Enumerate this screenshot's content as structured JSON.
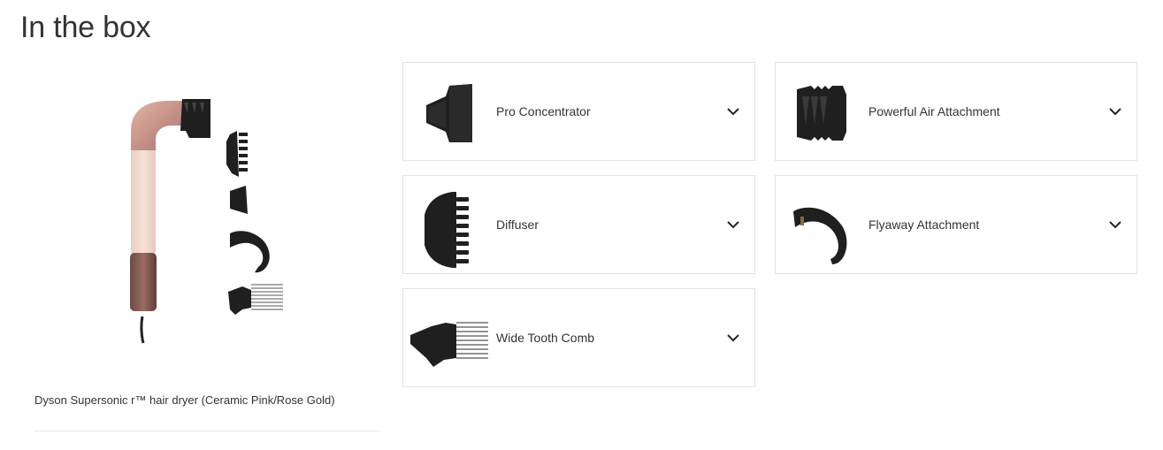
{
  "section": {
    "title": "In the box"
  },
  "hero": {
    "caption": "Dyson Supersonic r™ hair dryer (Ceramic Pink/Rose Gold)",
    "image_icon": "hair-dryer-with-attachments"
  },
  "items": [
    {
      "label": "Pro Concentrator",
      "icon": "pro-concentrator-icon"
    },
    {
      "label": "Powerful Air Attachment",
      "icon": "powerful-air-attachment-icon"
    },
    {
      "label": "Diffuser",
      "icon": "diffuser-icon"
    },
    {
      "label": "Flyaway Attachment",
      "icon": "flyaway-attachment-icon"
    },
    {
      "label": "Wide Tooth Comb",
      "icon": "wide-tooth-comb-icon"
    }
  ],
  "colors": {
    "attachment": "#1f1f1f",
    "pink_body": "#f1d6cc",
    "rose_gold": "#c58c7f",
    "border": "#e3e3e3"
  }
}
